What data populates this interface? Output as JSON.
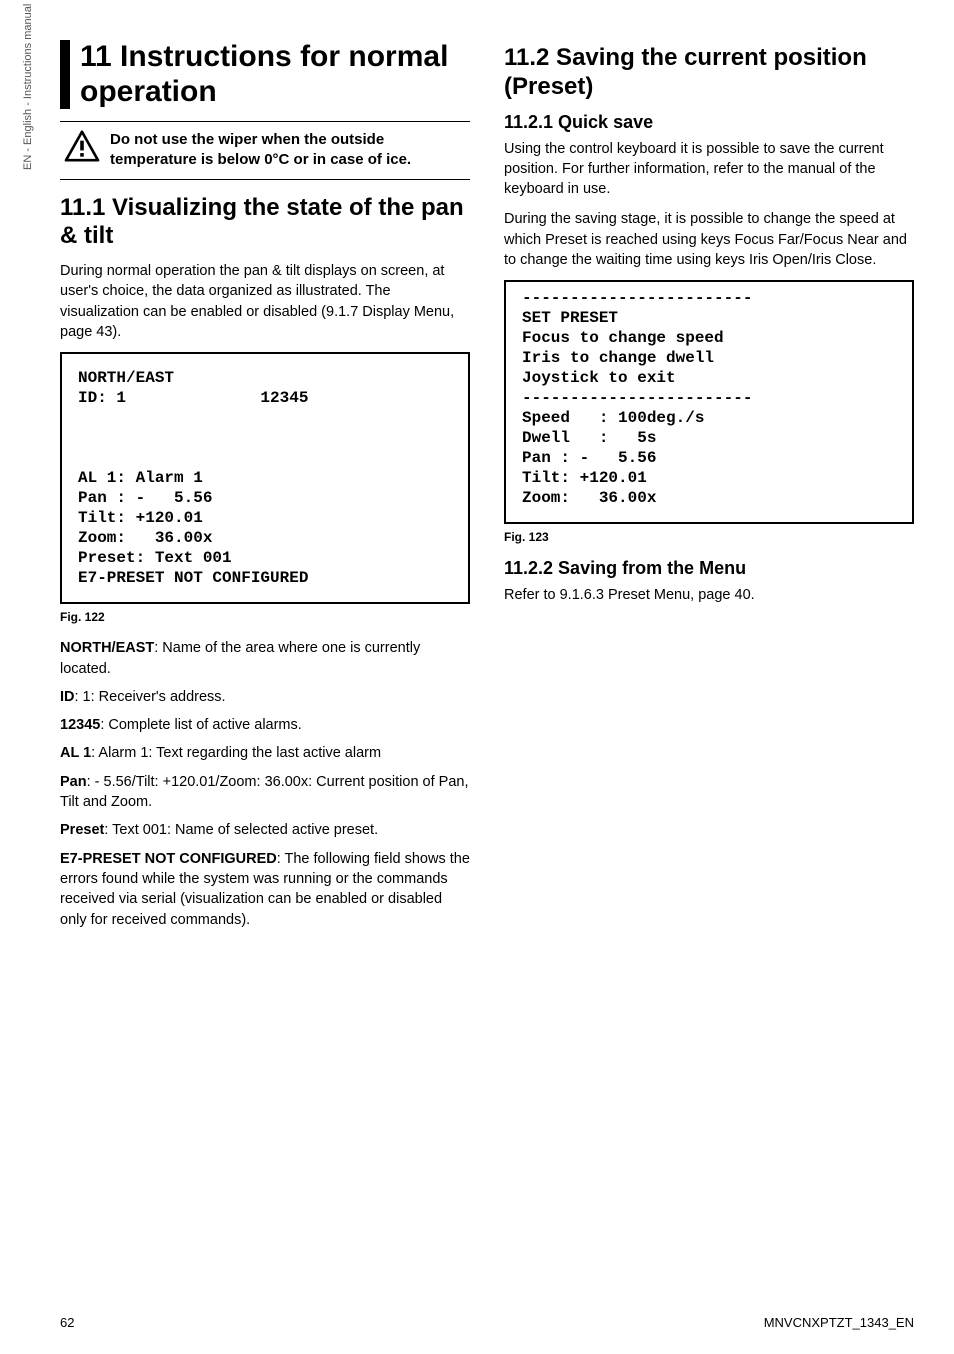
{
  "side_label": "EN - English - Instructions manual",
  "chapter": {
    "title": "11 Instructions for normal operation"
  },
  "warning": {
    "text": "Do not use the wiper when the outside temperature is below 0°C or in case of ice."
  },
  "left": {
    "h2": "11.1 Visualizing the state of the pan & tilt",
    "p1": "During normal operation the pan & tilt displays on screen, at user's choice, the data organized as illustrated. The visualization can be enabled or disabled (9.1.7 Display Menu, page 43).",
    "osd": "NORTH/EAST\nID: 1              12345\n\n\n\nAL 1: Alarm 1\nPan : -   5.56\nTilt: +120.01\nZoom:   36.00x\nPreset: Text 001\nE7-PRESET NOT CONFIGURED",
    "caption": "Fig. 122",
    "terms": [
      {
        "b": "NORTH/EAST",
        "rest": ": Name of the area where one is currently located."
      },
      {
        "b": "ID",
        "rest": ": 1: Receiver's address."
      },
      {
        "b": "12345",
        "rest": ": Complete list of active alarms."
      },
      {
        "b": "AL 1",
        "rest": ": Alarm 1: Text regarding the last active alarm"
      },
      {
        "b": "Pan",
        "rest": ": - 5.56/Tilt: +120.01/Zoom: 36.00x: Current position of Pan, Tilt and Zoom."
      },
      {
        "b": "Preset",
        "rest": ": Text 001: Name of selected active preset."
      },
      {
        "b": "E7-PRESET NOT CONFIGURED",
        "rest": ": The following field shows the errors found while the system was running or the commands received via serial (visualization can be enabled or disabled only for received commands)."
      }
    ]
  },
  "right": {
    "h2": "11.2 Saving the current position (Preset)",
    "s1": {
      "h3": "11.2.1 Quick save",
      "p1": "Using the control keyboard it is possible to save the current position. For further information, refer to the manual of the keyboard in use.",
      "p2": "During the saving stage, it is possible to change the speed at which Preset is reached using keys Focus Far/Focus Near and to change the waiting time using keys Iris Open/Iris Close.",
      "osd": "------------------------\nSET PRESET\nFocus to change speed\nIris to change dwell\nJoystick to exit\n------------------------\nSpeed   : 100deg./s\nDwell   :   5s\nPan : -   5.56\nTilt: +120.01\nZoom:   36.00x",
      "caption": "Fig. 123"
    },
    "s2": {
      "h3": "11.2.2 Saving from the Menu",
      "p1": "Refer to 9.1.6.3 Preset Menu, page 40."
    }
  },
  "footer": {
    "page": "62",
    "doc": "MNVCNXPTZT_1343_EN"
  }
}
